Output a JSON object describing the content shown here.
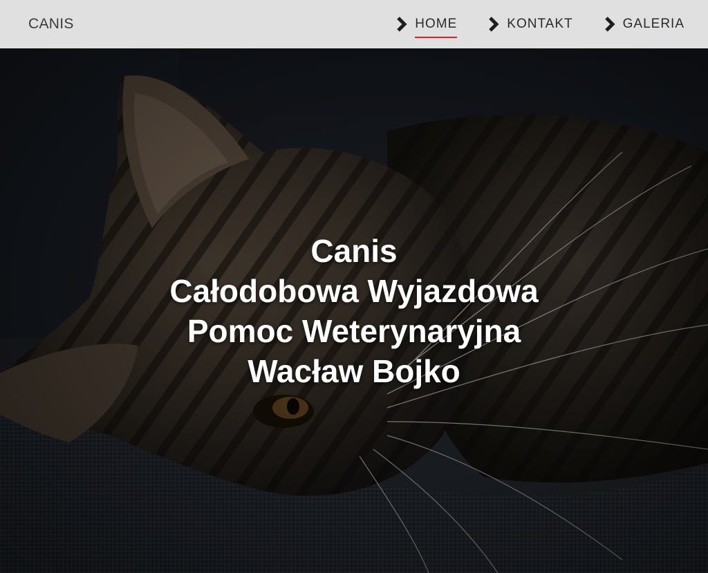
{
  "brand": {
    "name": "CANIS"
  },
  "nav": {
    "items": [
      {
        "label": "HOME",
        "active": true
      },
      {
        "label": "KONTAKT",
        "active": false
      },
      {
        "label": "GALERIA",
        "active": false
      }
    ]
  },
  "hero": {
    "line1": "Canis",
    "line2": "Całodobowa Wyjazdowa",
    "line3": "Pomoc Weterynaryjna",
    "line4": "Wacław Bojko",
    "image_icon": "kitten-photo"
  },
  "colors": {
    "navbar_bg": "#e0e0e0",
    "accent": "#e31e24",
    "hero_text": "#ffffff"
  }
}
